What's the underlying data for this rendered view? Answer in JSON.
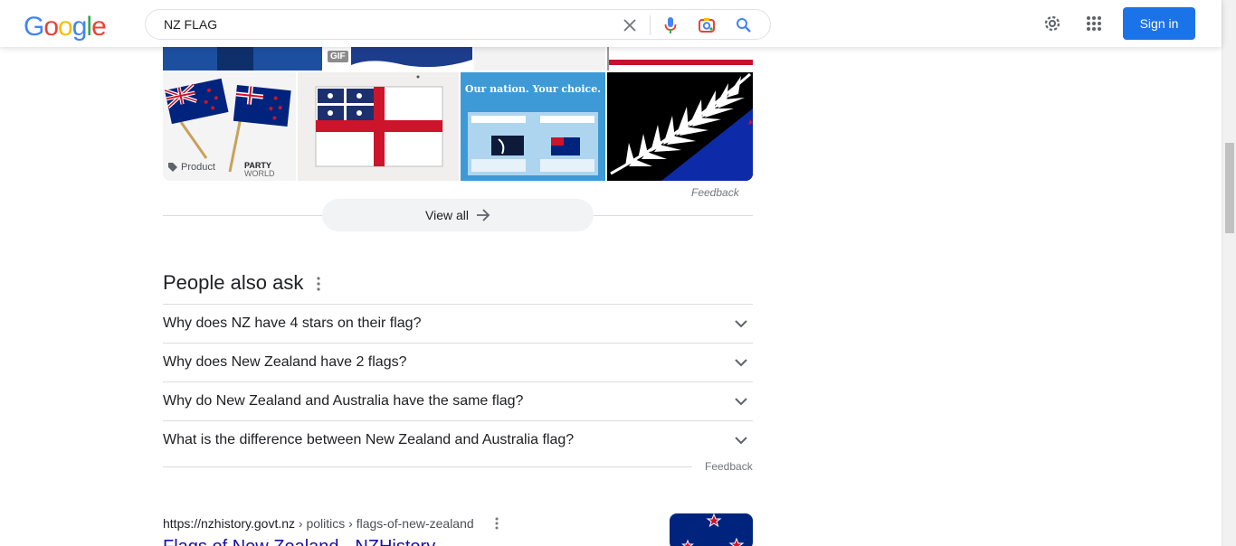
{
  "search": {
    "query": "NZ FLAG"
  },
  "header": {
    "signin_label": "Sign in"
  },
  "logo": {
    "letters": [
      "G",
      "o",
      "o",
      "g",
      "l",
      "e"
    ]
  },
  "images": {
    "product_badge": "Product",
    "party_text": "PARTY",
    "world_text": "WORLD",
    "gif_badge": "GIF",
    "poster_headline": "Our nation. Your choice.",
    "feedback_label": "Feedback",
    "view_all_label": "View all"
  },
  "paa": {
    "title": "People also ask",
    "questions": [
      "Why does NZ have 4 stars on their flag?",
      "Why does New Zealand have 2 flags?",
      "Why do New Zealand and Australia have the same flag?",
      "What is the difference between New Zealand and Australia flag?"
    ],
    "feedback_label": "Feedback"
  },
  "result": {
    "domain": "https://nzhistory.govt.nz",
    "breadcrumb": " › politics › flags-of-new-zealand",
    "title": "Flags of New Zealand - NZHistory"
  },
  "colors": {
    "accent": "#1a73e8",
    "link": "#1a0dab",
    "nz_blue": "#00247d",
    "nz_red": "#cc142b"
  }
}
